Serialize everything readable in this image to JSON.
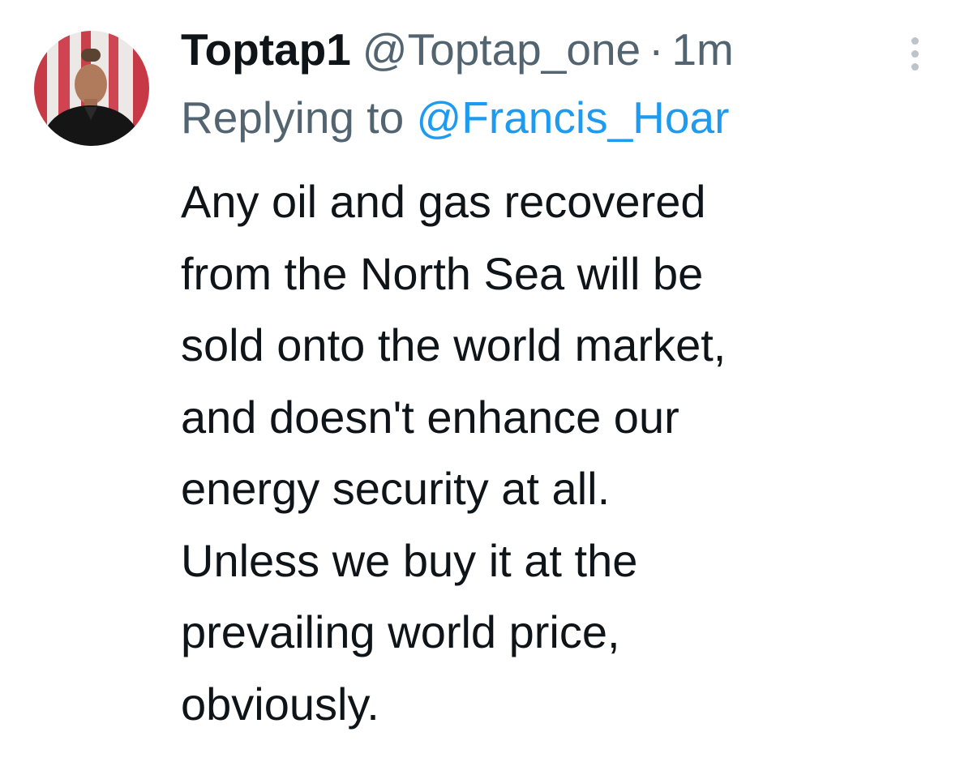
{
  "tweet": {
    "author": {
      "display_name": "Toptap1",
      "handle": "@Toptap_one",
      "avatar_icon": "profile-photo"
    },
    "separator": "·",
    "timestamp": "1m",
    "more_icon": "vertical-ellipsis-icon",
    "reply": {
      "prefix": "Replying to ",
      "mention": "@Francis_Hoar"
    },
    "text_lines": [
      "Any oil and gas recovered",
      "from the North Sea will be",
      "sold onto the world market,",
      "and doesn't enhance our",
      "energy security at all.",
      "Unless we buy it at the",
      "prevailing world price,",
      "obviously."
    ]
  },
  "colors": {
    "primary_text": "#0f1419",
    "secondary_text": "#536471",
    "link": "#1d9bf0",
    "menu_dots": "#bcc3c9"
  }
}
